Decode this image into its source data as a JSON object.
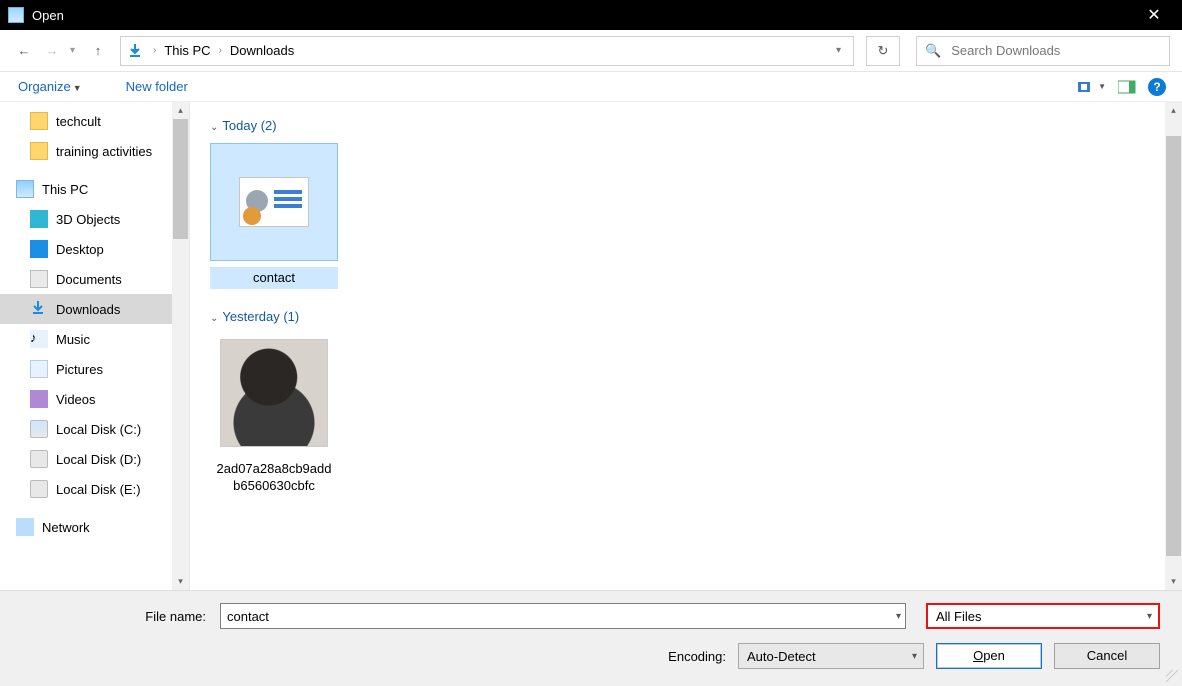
{
  "titlebar": {
    "title": "Open"
  },
  "breadcrumb": {
    "root": "This PC",
    "current": "Downloads"
  },
  "search": {
    "placeholder": "Search Downloads"
  },
  "toolbar": {
    "organize": "Organize",
    "new_folder": "New folder"
  },
  "tree": {
    "quick": [
      {
        "label": "techcult"
      },
      {
        "label": "training activities"
      }
    ],
    "this_pc": "This PC",
    "children": [
      {
        "label": "3D Objects"
      },
      {
        "label": "Desktop"
      },
      {
        "label": "Documents"
      },
      {
        "label": "Downloads",
        "selected": true
      },
      {
        "label": "Music"
      },
      {
        "label": "Pictures"
      },
      {
        "label": "Videos"
      },
      {
        "label": "Local Disk (C:)"
      },
      {
        "label": "Local Disk (D:)"
      },
      {
        "label": "Local Disk (E:)"
      }
    ],
    "network": "Network"
  },
  "groups": {
    "today": {
      "header": "Today (2)",
      "items": [
        {
          "caption": "contact",
          "selected": true
        }
      ]
    },
    "yesterday": {
      "header": "Yesterday (1)",
      "items": [
        {
          "caption": "2ad07a28a8cb9addb6560630cbfc"
        }
      ]
    }
  },
  "bottom": {
    "filename_label": "File name:",
    "filename_value": "contact",
    "filetype_value": "All Files",
    "encoding_label": "Encoding:",
    "encoding_value": "Auto-Detect",
    "open_prefix": "O",
    "open_rest": "pen",
    "cancel": "Cancel"
  }
}
